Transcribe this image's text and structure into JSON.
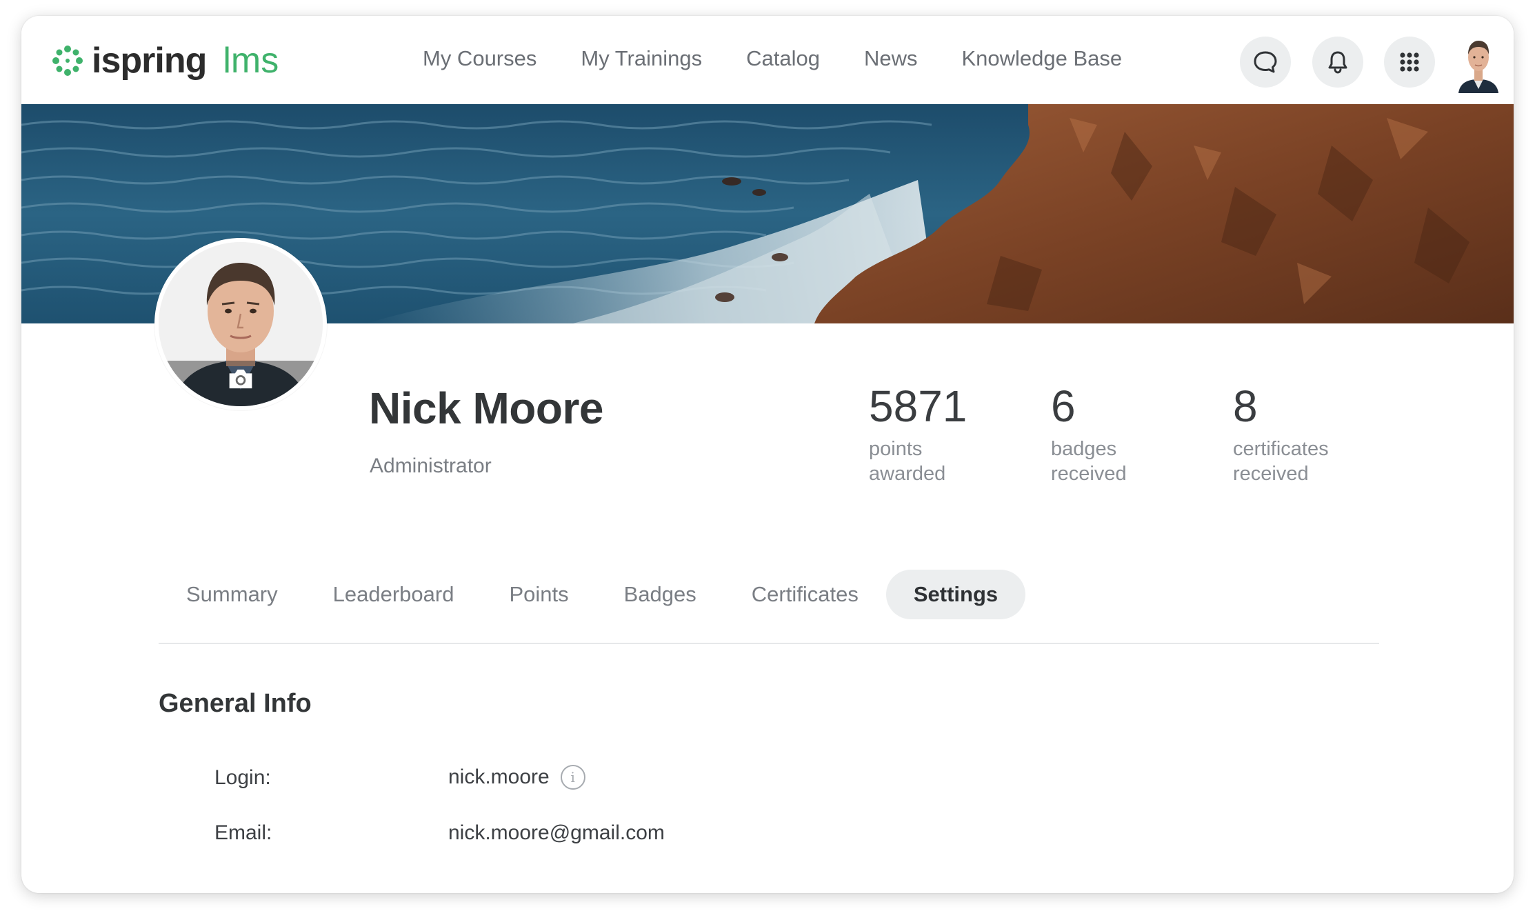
{
  "app": {
    "logo_text": "ispring",
    "logo_suffix": "lms",
    "brand_color": "#3fb26b"
  },
  "nav": {
    "items": [
      {
        "label": "My Courses"
      },
      {
        "label": "My Trainings"
      },
      {
        "label": "Catalog"
      },
      {
        "label": "News"
      },
      {
        "label": "Knowledge Base"
      }
    ]
  },
  "header_icons": {
    "chat": "chat-bubble-icon",
    "notifications": "bell-icon",
    "apps": "apps-grid-icon"
  },
  "profile": {
    "name": "Nick Moore",
    "role": "Administrator",
    "camera_icon": "camera-icon"
  },
  "stats": [
    {
      "value": "5871",
      "label_line1": "points",
      "label_line2": "awarded"
    },
    {
      "value": "6",
      "label_line1": "badges",
      "label_line2": "received"
    },
    {
      "value": "8",
      "label_line1": "certificates",
      "label_line2": "received"
    }
  ],
  "tabs": [
    {
      "label": "Summary"
    },
    {
      "label": "Leaderboard"
    },
    {
      "label": "Points"
    },
    {
      "label": "Badges"
    },
    {
      "label": "Certificates"
    },
    {
      "label": "Settings",
      "active": true
    }
  ],
  "general_info": {
    "title": "General Info",
    "login_label": "Login:",
    "login_value": "nick.moore",
    "email_label": "Email:",
    "email_value": "nick.moore@gmail.com",
    "info_icon": "info-icon"
  }
}
